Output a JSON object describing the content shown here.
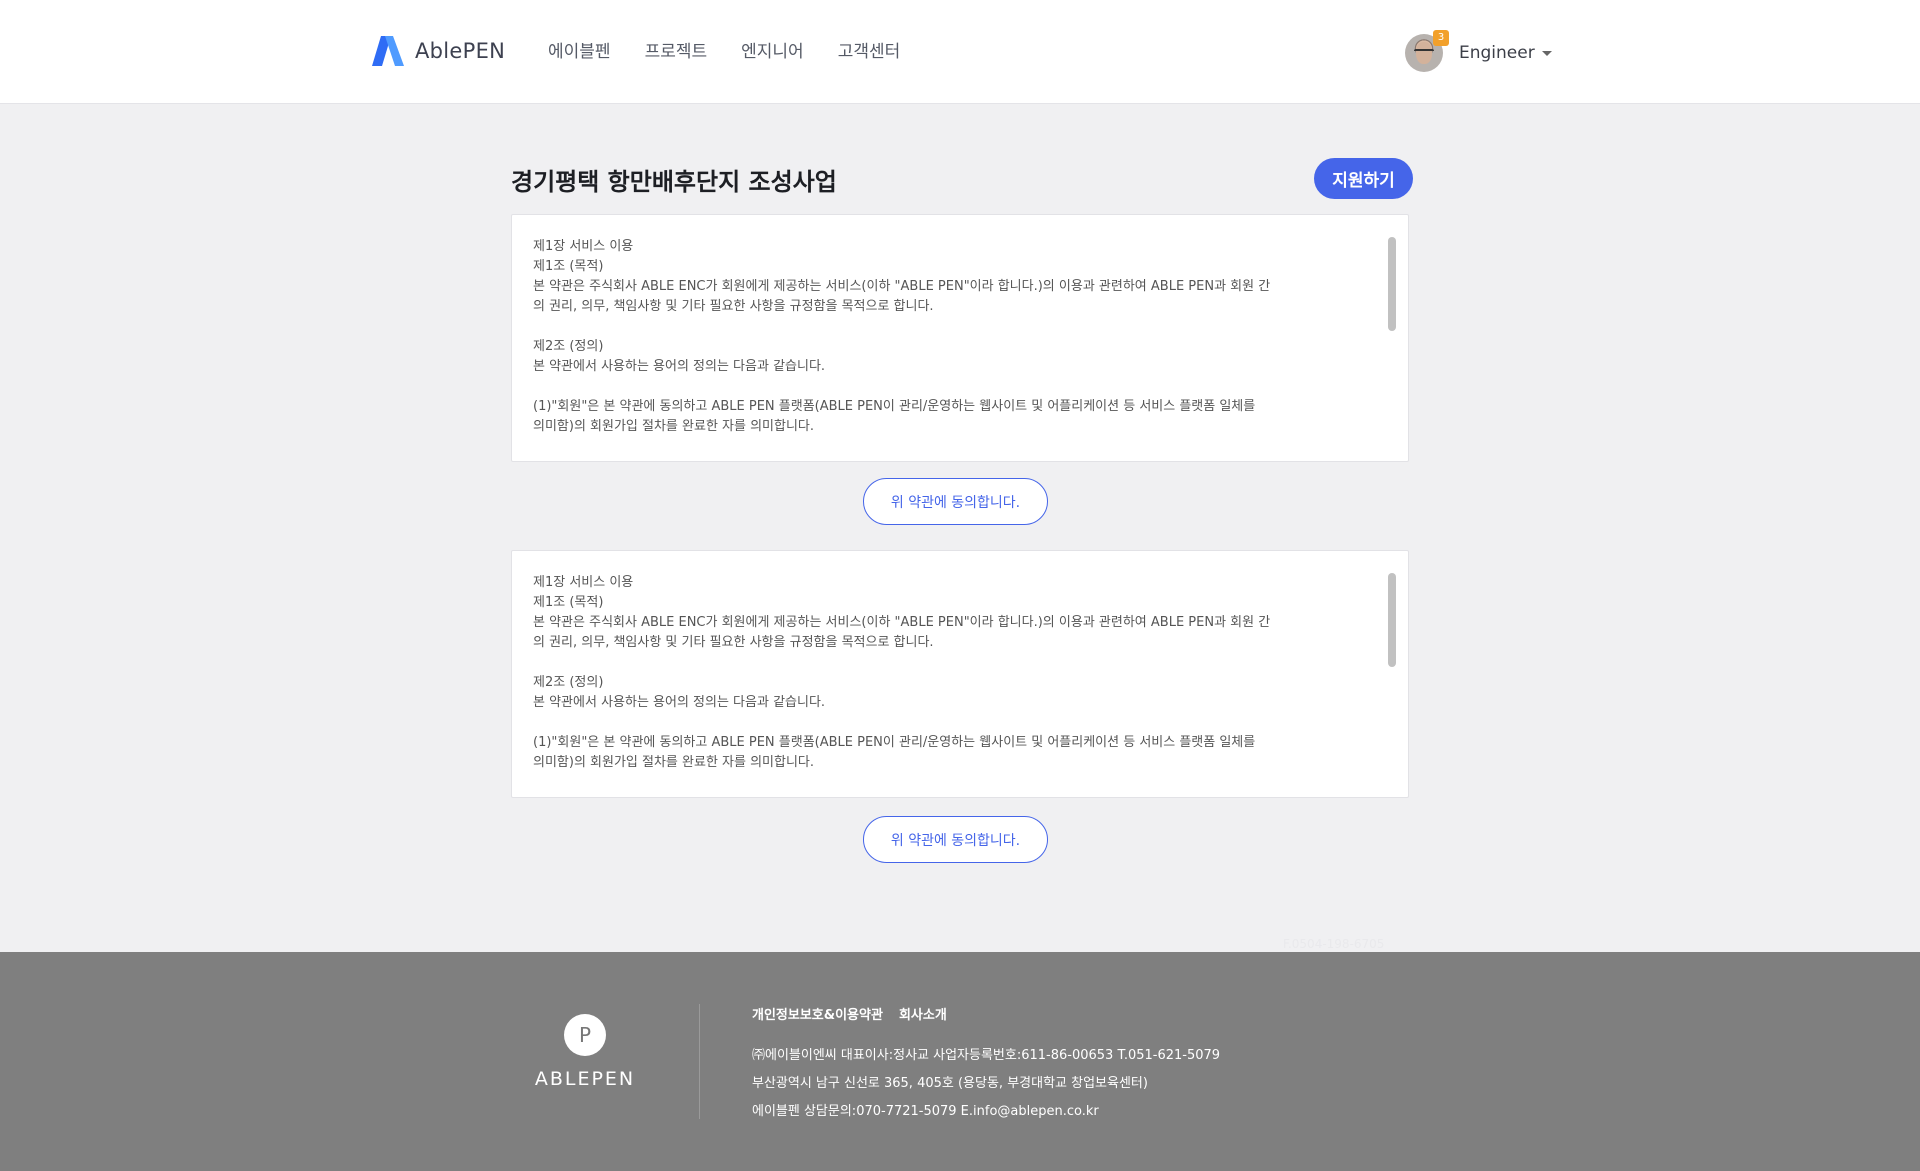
{
  "header": {
    "logo_text": "AblePEN",
    "nav": [
      "에이블펜",
      "프로젝트",
      "엔지니어",
      "고객센터"
    ],
    "user": {
      "name": "Engineer",
      "badge_count": "3"
    }
  },
  "main": {
    "title": "경기평택 항만배후단지 조성사업",
    "apply_label": "지원하기",
    "terms": [
      {
        "lines": [
          "제1장 서비스 이용",
          "제1조 (목적)",
          "본 약관은 주식회사 ABLE ENC가 회원에게 제공하는 서비스(이하 \"ABLE PEN\"이라 합니다.)의 이용과 관련하여 ABLE PEN과 회원 간",
          "의 권리, 의무, 책임사항 및 기타 필요한 사항을 규정함을 목적으로 합니다.",
          "",
          "제2조 (정의)",
          "본 약관에서 사용하는 용어의 정의는 다음과 같습니다.",
          "",
          "(1)\"회원\"은 본 약관에 동의하고 ABLE PEN 플랫폼(ABLE PEN이 관리/운영하는 웹사이트 및 어플리케이션 등 서비스 플랫폼 일체를",
          "의미함)의 회원가입 절차를 완료한 자를 의미합니다."
        ],
        "agree_label": "위 약관에 동의합니다."
      },
      {
        "lines": [
          "제1장 서비스 이용",
          "제1조 (목적)",
          "본 약관은 주식회사 ABLE ENC가 회원에게 제공하는 서비스(이하 \"ABLE PEN\"이라 합니다.)의 이용과 관련하여 ABLE PEN과 회원 간",
          "의 권리, 의무, 책임사항 및 기타 필요한 사항을 규정함을 목적으로 합니다.",
          "",
          "제2조 (정의)",
          "본 약관에서 사용하는 용어의 정의는 다음과 같습니다.",
          "",
          "(1)\"회원\"은 본 약관에 동의하고 ABLE PEN 플랫폼(ABLE PEN이 관리/운영하는 웹사이트 및 어플리케이션 등 서비스 플랫폼 일체를",
          "의미함)의 회원가입 절차를 완료한 자를 의미합니다."
        ],
        "agree_label": "위 약관에 동의합니다."
      }
    ],
    "fax": "F.0504-198-6705"
  },
  "footer": {
    "logo_letter": "P",
    "logo_text": "ABLEPEN",
    "links": [
      "개인정보보호&이용약관",
      "회사소개"
    ],
    "info": [
      "㈜에이블이엔씨   대표이사:정사교   사업자등록번호:611-86-00653   T.051-621-5079",
      "부산광역시 남구 신선로 365, 405호 (용당동, 부경대학교 창업보육센터)",
      "에이블펜 상담문의:070-7721-5079    E.info@ablepen.co.kr"
    ]
  },
  "colors": {
    "accent": "#4565e9",
    "badge": "#f2a02b",
    "footer_bg": "#7f7f7f",
    "page_bg": "#f0f0f2"
  }
}
